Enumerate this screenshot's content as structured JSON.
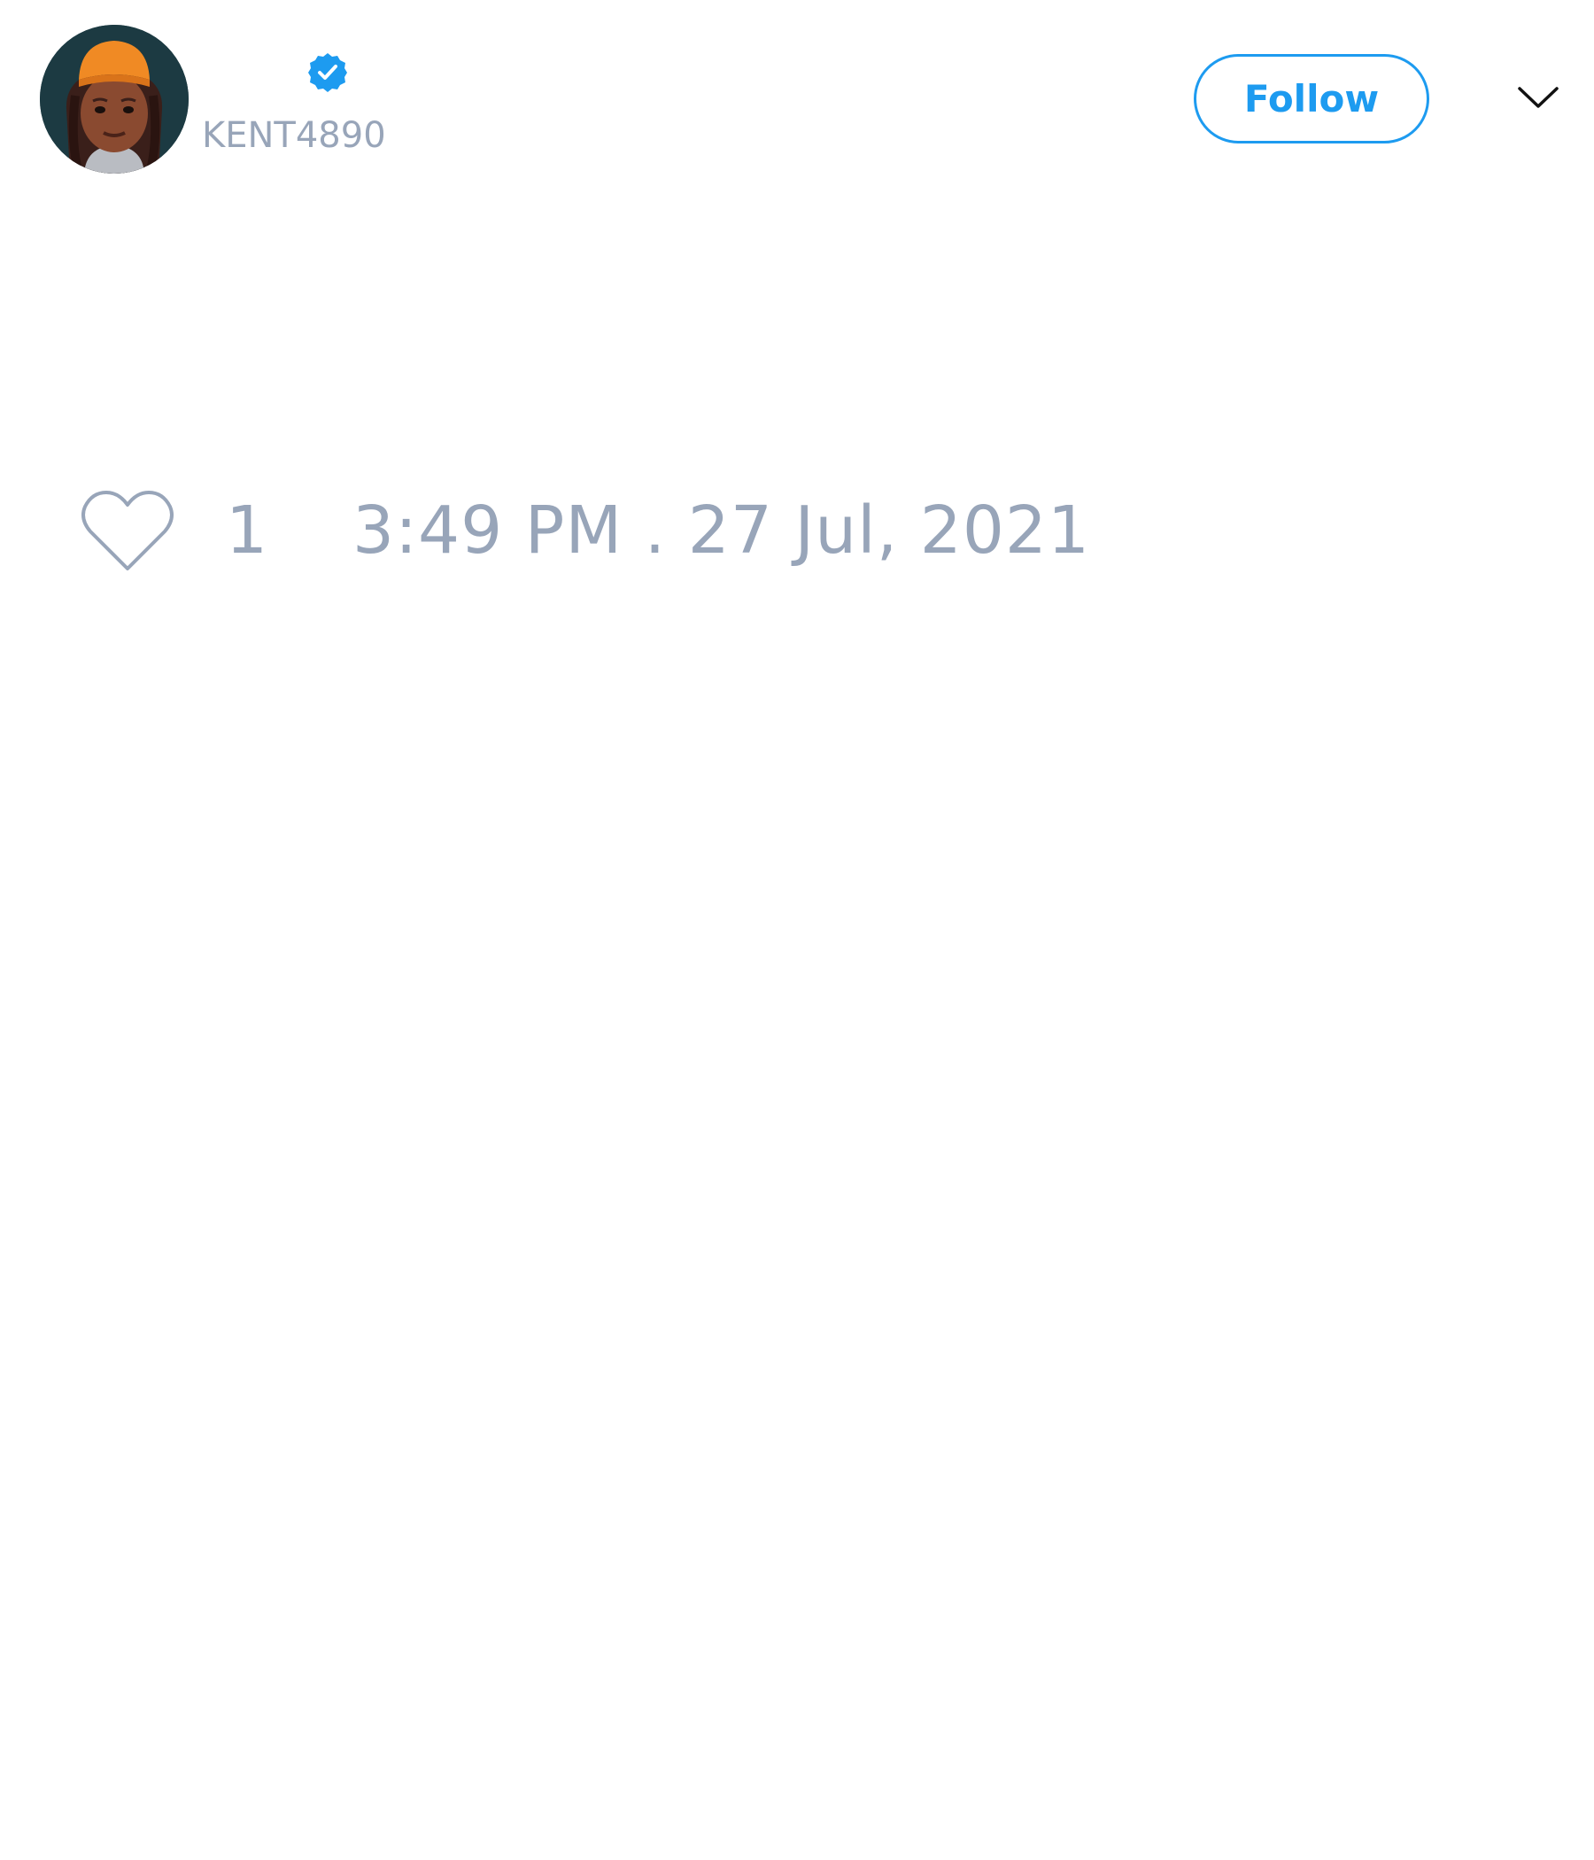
{
  "tweet": {
    "author": {
      "handle": "KENT4890",
      "verified": true
    },
    "follow_label": "Follow",
    "like_count": "1",
    "timestamp": "3:49 PM . 27 Jul, 2021"
  },
  "icons": {
    "verified": "verified-badge-icon",
    "menu": "chevron-down-icon",
    "like": "heart-outline-icon"
  },
  "colors": {
    "accent": "#1d9bf0",
    "muted_text": "#98a5b9",
    "background": "#ffffff"
  }
}
